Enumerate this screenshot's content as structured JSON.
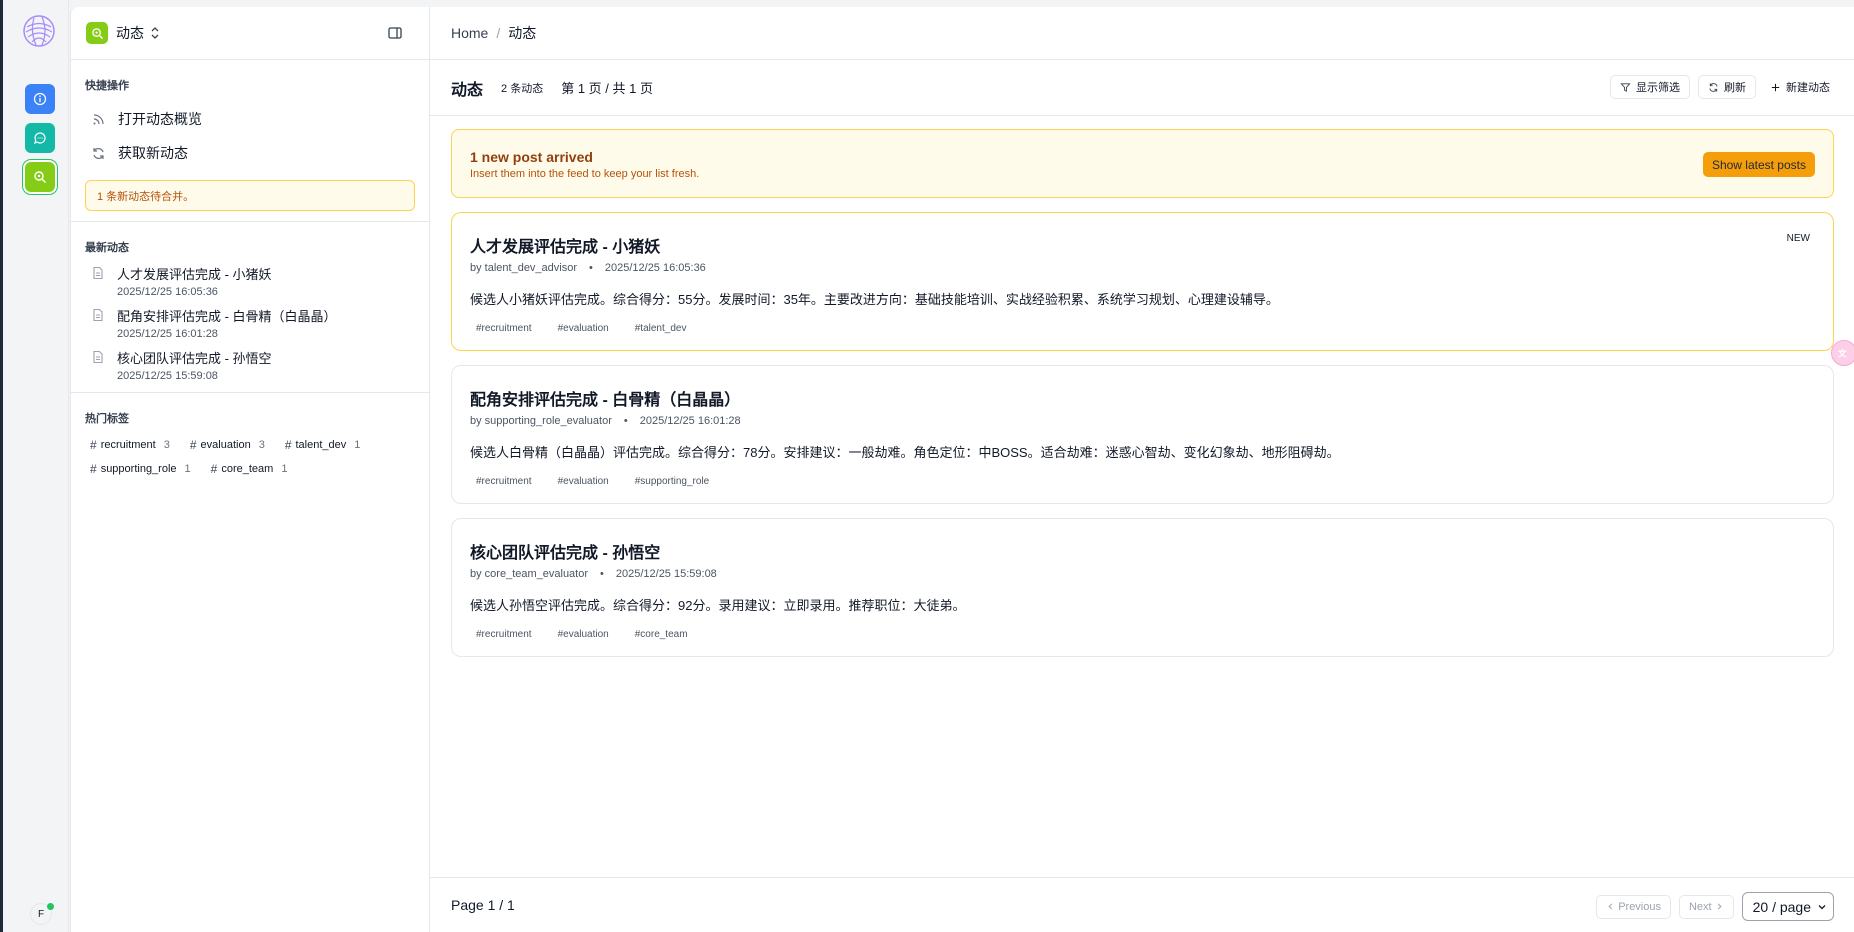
{
  "app": {
    "name": "动态"
  },
  "rail": {
    "avatar_letter": "F"
  },
  "sidebar": {
    "quick_actions_title": "快捷操作",
    "actions": [
      {
        "label": "打开动态概览",
        "icon": "rss-icon"
      },
      {
        "label": "获取新动态",
        "icon": "refresh-icon"
      }
    ],
    "pending_notice": "1 条新动态待合并。",
    "recent_title": "最新动态",
    "recent": [
      {
        "title": "人才发展评估完成 - 小猪妖",
        "time": "2025/12/25 16:05:36"
      },
      {
        "title": "配角安排评估完成 - 白骨精（白晶晶）",
        "time": "2025/12/25 16:01:28"
      },
      {
        "title": "核心团队评估完成 - 孙悟空",
        "time": "2025/12/25 15:59:08"
      }
    ],
    "hot_tags_title": "热门标签",
    "hot_tags": [
      {
        "name": "recruitment",
        "count": "3"
      },
      {
        "name": "evaluation",
        "count": "3"
      },
      {
        "name": "talent_dev",
        "count": "1"
      },
      {
        "name": "supporting_role",
        "count": "1"
      },
      {
        "name": "core_team",
        "count": "1"
      }
    ]
  },
  "breadcrumb": {
    "home": "Home",
    "separator": "/",
    "current": "动态"
  },
  "header": {
    "title": "动态",
    "count": "2 条动态",
    "pages": "第 1 页 / 共 1 页",
    "filter_label": "显示筛选",
    "refresh_label": "刷新",
    "new_label": "新建动态"
  },
  "banner": {
    "title": "1 new post arrived",
    "subtitle": "Insert them into the feed to keep your list fresh.",
    "button": "Show latest posts"
  },
  "posts": [
    {
      "title": "人才发展评估完成 - 小猪妖",
      "author": "by talent_dev_advisor",
      "time": "2025/12/25 16:05:36",
      "body": "候选人小猪妖评估完成。综合得分：55分。发展时间：35年。主要改进方向：基础技能培训、实战经验积累、系统学习规划、心理建设辅导。",
      "tags": [
        "#recruitment",
        "#evaluation",
        "#talent_dev"
      ],
      "badge": "NEW"
    },
    {
      "title": "配角安排评估完成 - 白骨精（白晶晶）",
      "author": "by supporting_role_evaluator",
      "time": "2025/12/25 16:01:28",
      "body": "候选人白骨精（白晶晶）评估完成。综合得分：78分。安排建议：一般劫难。角色定位：中BOSS。适合劫难：迷惑心智劫、变化幻象劫、地形阻碍劫。",
      "tags": [
        "#recruitment",
        "#evaluation",
        "#supporting_role"
      ]
    },
    {
      "title": "核心团队评估完成 - 孙悟空",
      "author": "by core_team_evaluator",
      "time": "2025/12/25 15:59:08",
      "body": "候选人孙悟空评估完成。综合得分：92分。录用建议：立即录用。推荐职位：大徒弟。",
      "tags": [
        "#recruitment",
        "#evaluation",
        "#core_team"
      ]
    }
  ],
  "footer": {
    "page": "Page 1 / 1",
    "previous": "Previous",
    "next": "Next",
    "per_page": "20 / page"
  },
  "colors": {
    "accent_green": "#84cc16",
    "accent_blue": "#3b82f6",
    "accent_teal": "#14b8a6",
    "warning_bg": "#fffbeb",
    "warning_border": "#fcd34d",
    "warning_button": "#f59e0b"
  }
}
